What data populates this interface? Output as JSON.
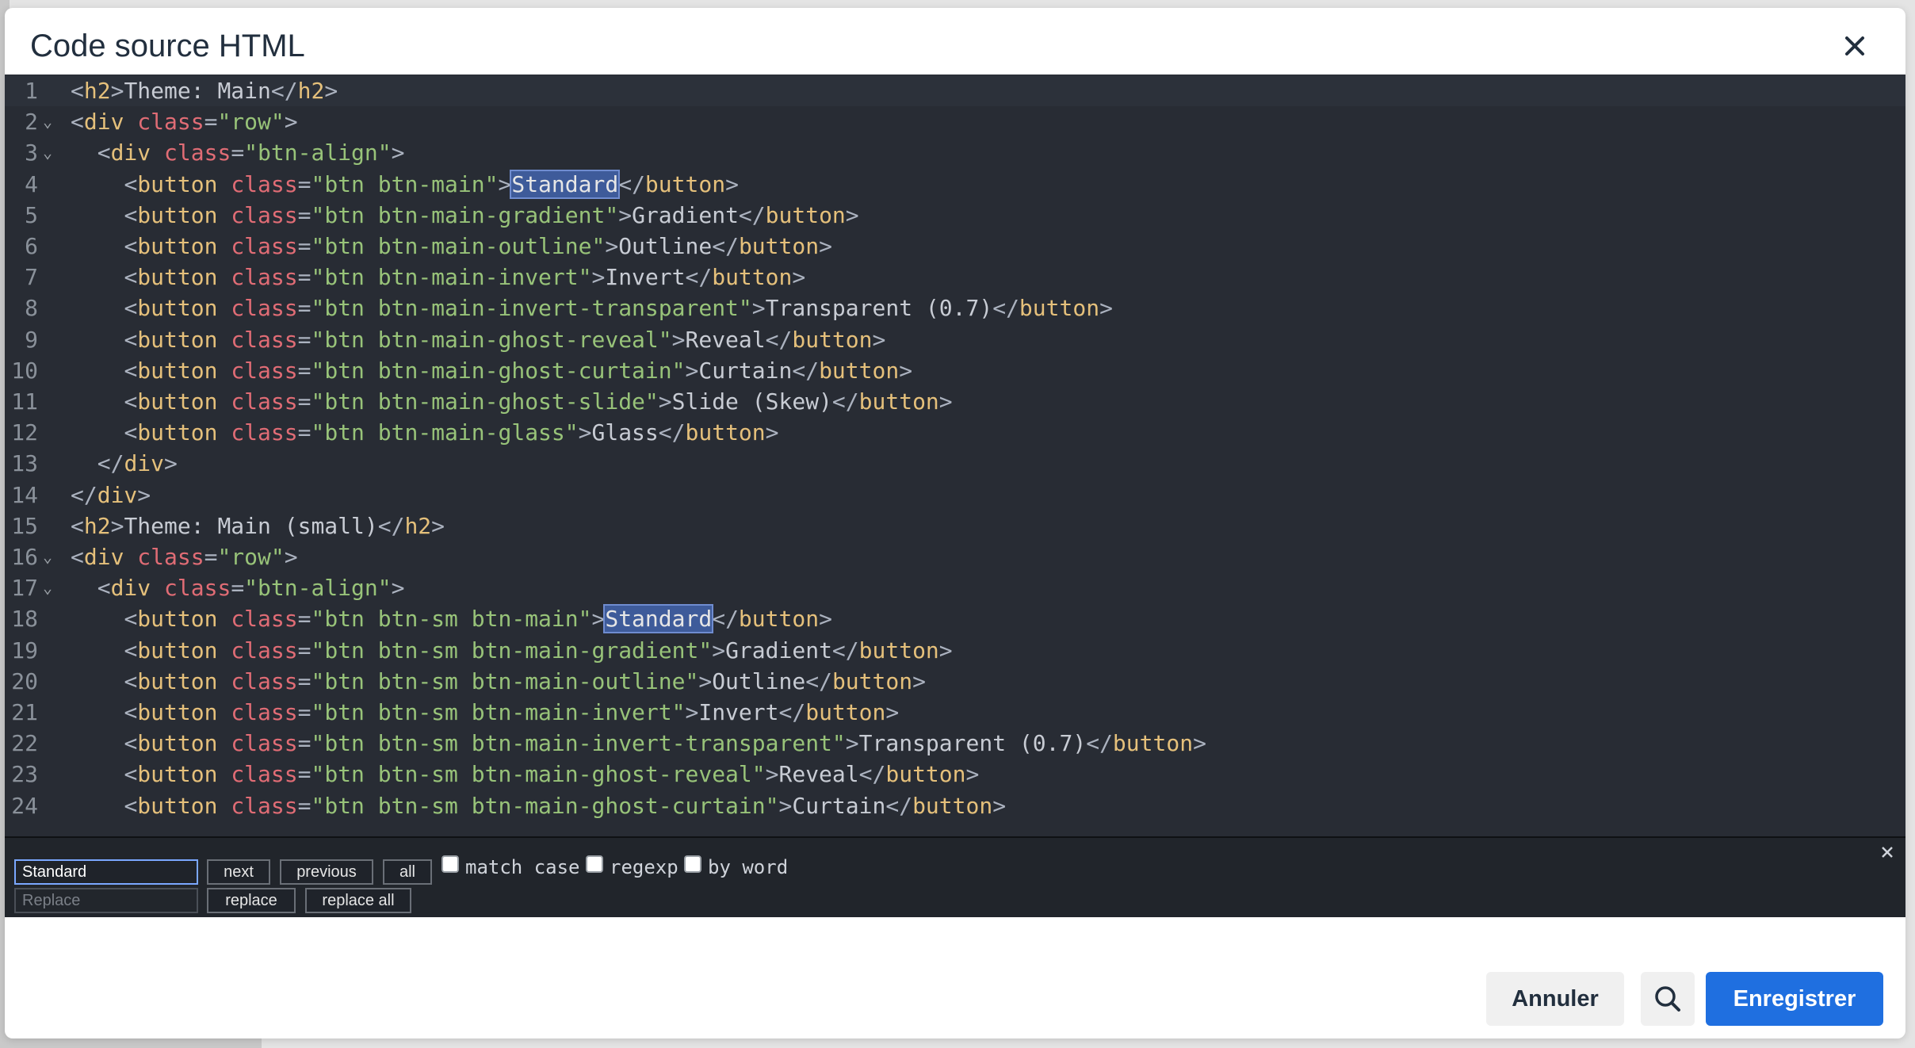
{
  "dialog": {
    "title": "Code source HTML",
    "close_icon": "close-icon"
  },
  "editor": {
    "lines": [
      {
        "n": "1",
        "fold": "",
        "code": "<h2>Theme: Main</h2>"
      },
      {
        "n": "2",
        "fold": "⌄",
        "code": "<div class=\"row\">"
      },
      {
        "n": "3",
        "fold": "⌄",
        "code": "  <div class=\"btn-align\">"
      },
      {
        "n": "4",
        "fold": "",
        "code": "    <button class=\"btn btn-main\">Standard</button>",
        "highlight": "Standard"
      },
      {
        "n": "5",
        "fold": "",
        "code": "    <button class=\"btn btn-main-gradient\">Gradient</button>"
      },
      {
        "n": "6",
        "fold": "",
        "code": "    <button class=\"btn btn-main-outline\">Outline</button>"
      },
      {
        "n": "7",
        "fold": "",
        "code": "    <button class=\"btn btn-main-invert\">Invert</button>"
      },
      {
        "n": "8",
        "fold": "",
        "code": "    <button class=\"btn btn-main-invert-transparent\">Transparent (0.7)</button>"
      },
      {
        "n": "9",
        "fold": "",
        "code": "    <button class=\"btn btn-main-ghost-reveal\">Reveal</button>"
      },
      {
        "n": "10",
        "fold": "",
        "code": "    <button class=\"btn btn-main-ghost-curtain\">Curtain</button>"
      },
      {
        "n": "11",
        "fold": "",
        "code": "    <button class=\"btn btn-main-ghost-slide\">Slide (Skew)</button>"
      },
      {
        "n": "12",
        "fold": "",
        "code": "    <button class=\"btn btn-main-glass\">Glass</button>"
      },
      {
        "n": "13",
        "fold": "",
        "code": "  </div>"
      },
      {
        "n": "14",
        "fold": "",
        "code": "</div>"
      },
      {
        "n": "15",
        "fold": "",
        "code": "<h2>Theme: Main (small)</h2>"
      },
      {
        "n": "16",
        "fold": "⌄",
        "code": "<div class=\"row\">"
      },
      {
        "n": "17",
        "fold": "⌄",
        "code": "  <div class=\"btn-align\">"
      },
      {
        "n": "18",
        "fold": "",
        "code": "    <button class=\"btn btn-sm btn-main\">Standard</button>",
        "highlight": "Standard"
      },
      {
        "n": "19",
        "fold": "",
        "code": "    <button class=\"btn btn-sm btn-main-gradient\">Gradient</button>"
      },
      {
        "n": "20",
        "fold": "",
        "code": "    <button class=\"btn btn-sm btn-main-outline\">Outline</button>"
      },
      {
        "n": "21",
        "fold": "",
        "code": "    <button class=\"btn btn-sm btn-main-invert\">Invert</button>"
      },
      {
        "n": "22",
        "fold": "",
        "code": "    <button class=\"btn btn-sm btn-main-invert-transparent\">Transparent (0.7)</button>"
      },
      {
        "n": "23",
        "fold": "",
        "code": "    <button class=\"btn btn-sm btn-main-ghost-reveal\">Reveal</button>"
      },
      {
        "n": "24",
        "fold": "",
        "code": "    <button class=\"btn btn-sm btn-main-ghost-curtain\">Curtain</button>"
      }
    ]
  },
  "search": {
    "value": "Standard",
    "replace_placeholder": "Replace",
    "next_label": "next",
    "previous_label": "previous",
    "all_label": "all",
    "match_case_label": "match case",
    "regexp_label": "regexp",
    "by_word_label": "by word",
    "replace_label": "replace",
    "replace_all_label": "replace all"
  },
  "footer": {
    "cancel_label": "Annuler",
    "save_label": "Enregistrer",
    "search_icon": "search-icon"
  },
  "colors": {
    "editor_bg": "#282c34",
    "tag": "#e5c07b",
    "attr": "#e06c75",
    "string": "#98c379",
    "primary": "#1f6fe0"
  }
}
